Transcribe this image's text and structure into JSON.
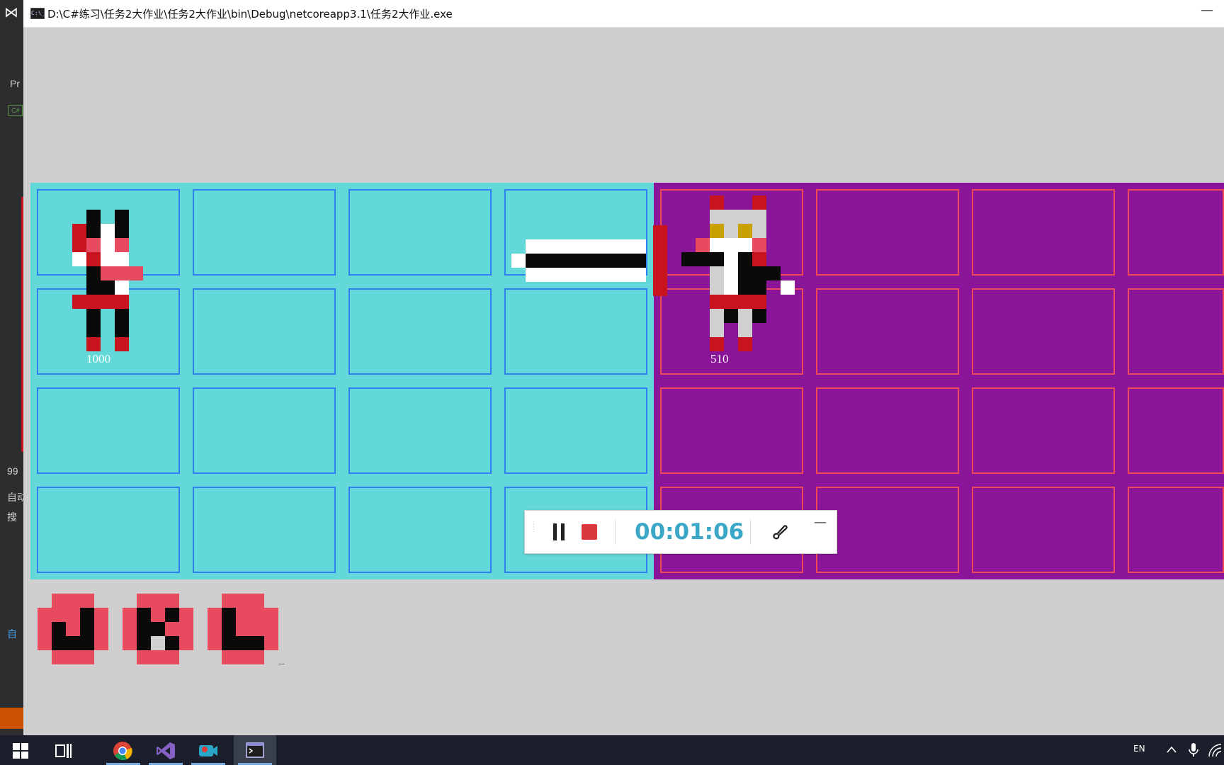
{
  "window": {
    "title": "D:\\C#练习\\任务2大作业\\任务2大作业\\bin\\Debug\\netcoreapp3.1\\任务2大作业.exe",
    "icon": "console-icon",
    "icon_text": "C:\\_",
    "minimize_symbol": "—"
  },
  "ide_strip": {
    "items": [
      "Pr",
      "99",
      "自动",
      "搜",
      "自"
    ]
  },
  "board": {
    "rows": 4,
    "left_cols": 4,
    "right_cols": 4,
    "left_color": "#63d8d8",
    "right_color": "#8a1599",
    "left_border": "#2f7ff0",
    "right_border": "#ef4a57"
  },
  "player": {
    "hp": "1000",
    "icon": "pixel-warrior-sprite"
  },
  "enemy": {
    "hp": "510",
    "icon": "pixel-knight-sprite"
  },
  "skills": [
    {
      "key": "J",
      "icon": "skill-j-icon"
    },
    {
      "key": "K",
      "icon": "skill-k-icon"
    },
    {
      "key": "L",
      "icon": "skill-l-icon"
    }
  ],
  "cursor": "_",
  "recorder": {
    "time": "00:01:06",
    "pause_icon": "pause-icon",
    "stop_icon": "stop-icon",
    "brush_icon": "brush-icon",
    "minimize_symbol": "—"
  },
  "taskbar": {
    "lang": "EN",
    "items": [
      "windows-start-icon",
      "task-view-icon",
      "chrome-icon",
      "visual-studio-icon",
      "screen-recorder-icon",
      "console-app-icon"
    ]
  },
  "colors": {
    "red": "#c8141f",
    "pink": "#e84a5f",
    "black": "#0a0a0a",
    "white": "#ffffff",
    "silver": "#d0d0d0",
    "gold": "#c8a000"
  }
}
